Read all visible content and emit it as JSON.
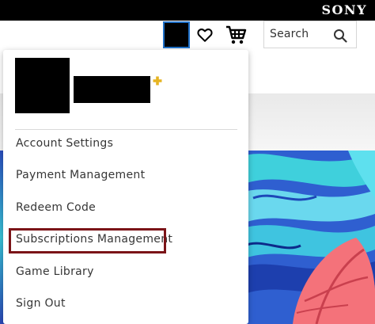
{
  "topbar": {
    "brand": "SONY"
  },
  "header": {
    "search": {
      "label": "Search"
    },
    "icons": {
      "avatar": "account-avatar-icon",
      "wishlist": "heart-icon",
      "cart": "cart-icon",
      "search": "search-icon",
      "plus": "playstation-plus-icon"
    }
  },
  "dropdown": {
    "items": [
      {
        "label": "Account Settings"
      },
      {
        "label": "Payment Management"
      },
      {
        "label": "Redeem Code"
      },
      {
        "label": "Subscriptions Management",
        "highlighted": true
      },
      {
        "label": "Game Library"
      },
      {
        "label": "Sign Out"
      }
    ]
  },
  "colors": {
    "topbar": "#000000",
    "avatar_focus_border": "#1f70c8",
    "highlight_border": "#7b1418",
    "plus_gold": "#e6b422",
    "menu_text": "#363636"
  }
}
